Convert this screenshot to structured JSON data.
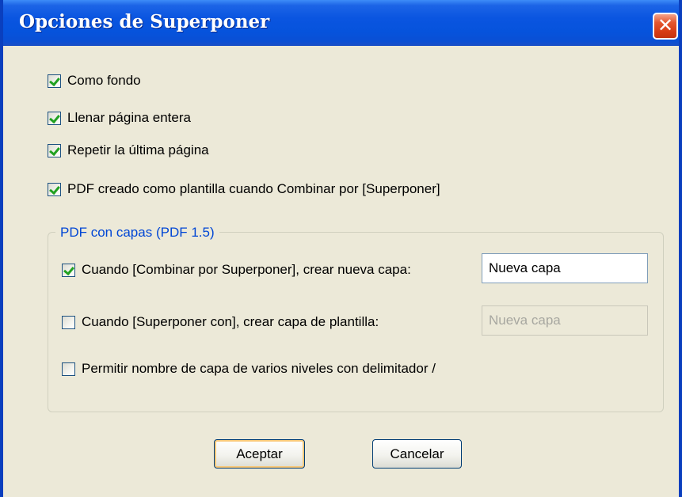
{
  "window": {
    "title": "Opciones de Superponer",
    "close_glyph": "✕"
  },
  "options": [
    {
      "label": "Como fondo",
      "checked": true
    },
    {
      "label": "Llenar página entera",
      "checked": true
    },
    {
      "label": "Repetir la última página",
      "checked": true
    },
    {
      "label": "PDF creado como plantilla cuando Combinar por [Superponer]",
      "checked": true
    }
  ],
  "layers_group": {
    "legend": "PDF con capas (PDF 1.5)",
    "items": [
      {
        "label": "Cuando [Combinar por Superponer], crear nueva capa:",
        "checked": true,
        "field_value": "Nueva capa",
        "field_enabled": true
      },
      {
        "label": "Cuando [Superponer con], crear capa de plantilla:",
        "checked": false,
        "field_value": "Nueva capa",
        "field_enabled": false
      },
      {
        "label": "Permitir nombre de capa de varios niveles con delimitador /",
        "checked": false
      }
    ]
  },
  "buttons": {
    "ok": "Aceptar",
    "cancel": "Cancelar"
  },
  "colors": {
    "titlebar": "#0a55e0",
    "dialog_bg": "#ece9d8",
    "group_legend": "#0046d5",
    "close_button": "#d63b14",
    "check_mark": "#21a121"
  }
}
